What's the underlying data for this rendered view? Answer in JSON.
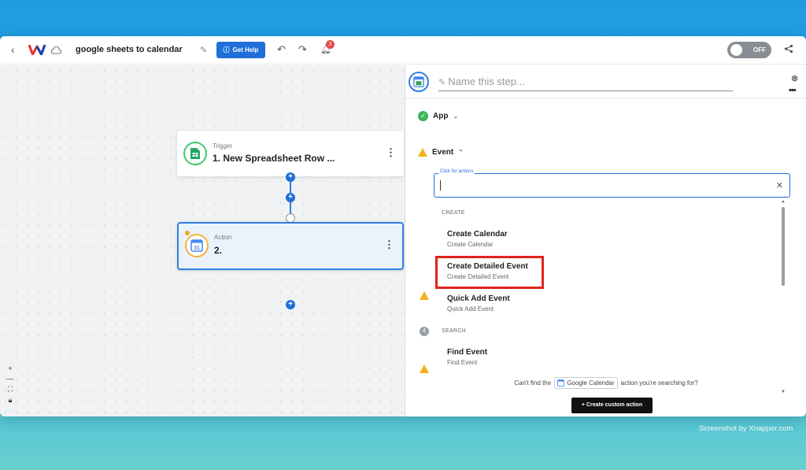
{
  "topbar": {
    "workflow_title": "google sheets to calendar",
    "help_label": "Get Help",
    "notification_count": "3",
    "toggle_label": "OFF"
  },
  "canvas": {
    "trigger": {
      "kind": "Trigger",
      "title": "1. New Spreadsheet Row ..."
    },
    "action": {
      "kind": "Action",
      "title": "2."
    }
  },
  "panel": {
    "name_placeholder": "Name this step...",
    "app_label": "App",
    "event_label": "Event",
    "search_label": "Click for actions",
    "step_number": "4",
    "sections": {
      "create": "CREATE",
      "search": "SEARCH"
    },
    "options": [
      {
        "title": "Create Calendar",
        "subtitle": "Create Calendar"
      },
      {
        "title": "Create Detailed Event",
        "subtitle": "Create Detailed Event"
      },
      {
        "title": "Quick Add Event",
        "subtitle": "Quick Add Event"
      },
      {
        "title": "Find Event",
        "subtitle": "Find Event"
      }
    ],
    "cant_find_prefix": "Can't find the",
    "cant_find_app": "Google Calendar",
    "cant_find_suffix": "action you're searching for?",
    "custom_action_label": "+ Create custom action"
  },
  "watermark": "Screenshot by Xnapper.com",
  "colors": {
    "primary": "#1e6fd9",
    "highlight": "#e0231d",
    "success": "#3cb55a",
    "warning": "#f2b21c"
  }
}
